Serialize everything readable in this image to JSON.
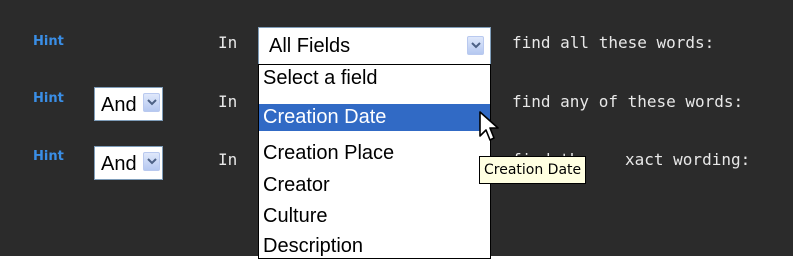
{
  "rows": [
    {
      "hint": "Hint",
      "operator": "",
      "in_label": "In",
      "find_label": "find all these words:"
    },
    {
      "hint": "Hint",
      "operator": "And",
      "in_label": "In",
      "find_label": "find any of these words:"
    },
    {
      "hint": "Hint",
      "operator": "And",
      "in_label": "In",
      "find_label_prefix": "find th",
      "find_label_suffix": "xact wording:"
    }
  ],
  "field_select": {
    "value": "All Fields",
    "options": [
      "Select a field",
      "Creation Date",
      "Creation Place",
      "Creator",
      "Culture",
      "Description"
    ],
    "highlighted": "Creation Date"
  },
  "tooltip": "Creation Date",
  "colors": {
    "panel_bg": "#2b2b2b",
    "hint": "#3a8ee6",
    "label_text": "#e8e8e8",
    "selection": "#316ac5",
    "tooltip_bg": "#ffffe1"
  }
}
